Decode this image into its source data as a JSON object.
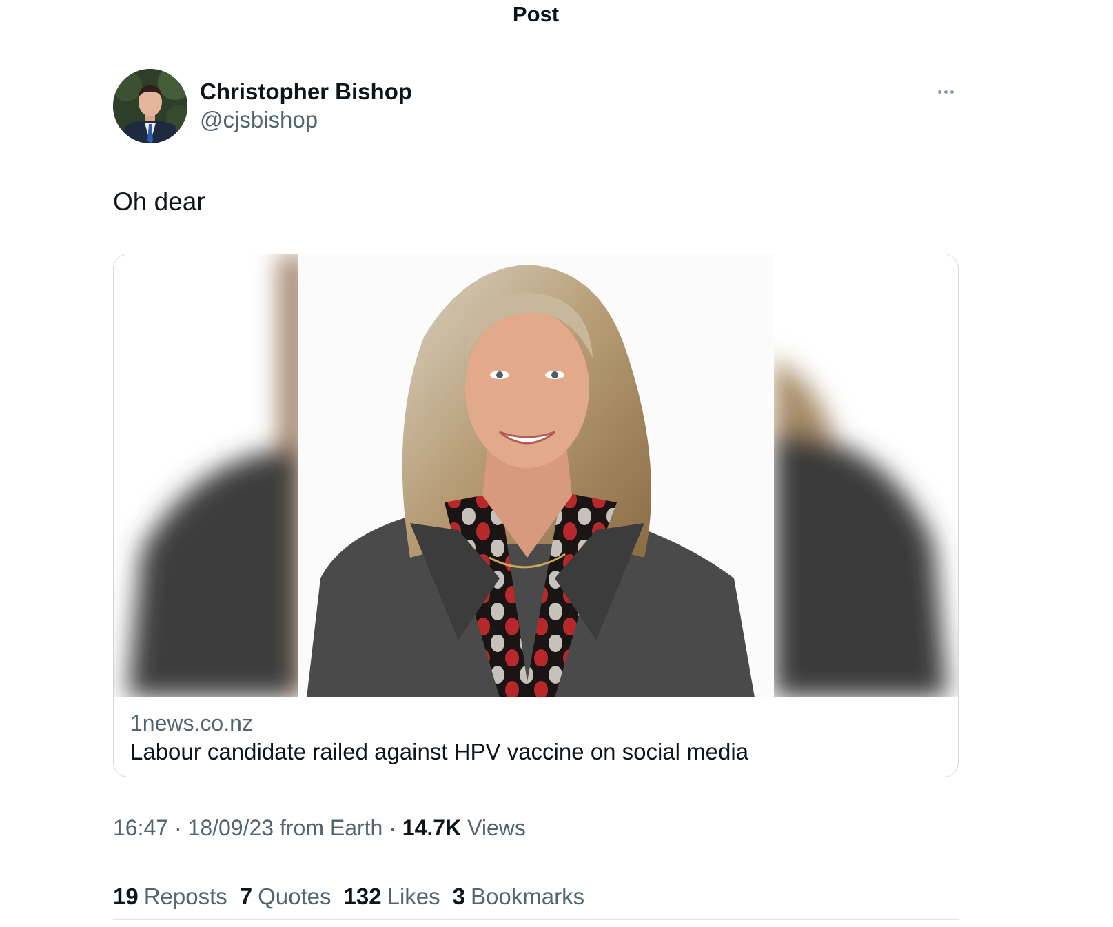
{
  "header": {
    "title": "Post"
  },
  "author": {
    "name": "Christopher Bishop",
    "handle": "@cjsbishop",
    "avatar_icon": "profile-photo"
  },
  "more_icon": "ellipsis-icon",
  "post": {
    "text": "Oh dear"
  },
  "link_card": {
    "domain": "1news.co.nz",
    "title": "Labour candidate railed against HPV vaccine on social media",
    "image": "portrait-photo-woman-grey-blazer"
  },
  "meta": {
    "time": "16:47",
    "sep1": " · ",
    "date": "18/09/23",
    "source": " from Earth",
    "sep2": " · ",
    "views_count": "14.7K",
    "views_label": "Views"
  },
  "stats": [
    {
      "count": "19",
      "label": "Reposts"
    },
    {
      "count": "7",
      "label": "Quotes"
    },
    {
      "count": "132",
      "label": "Likes"
    },
    {
      "count": "3",
      "label": "Bookmarks"
    }
  ],
  "colors": {
    "text_primary": "#0f1419",
    "text_secondary": "#536471",
    "border": "#cfd9de",
    "divider": "#dfe5e8"
  }
}
